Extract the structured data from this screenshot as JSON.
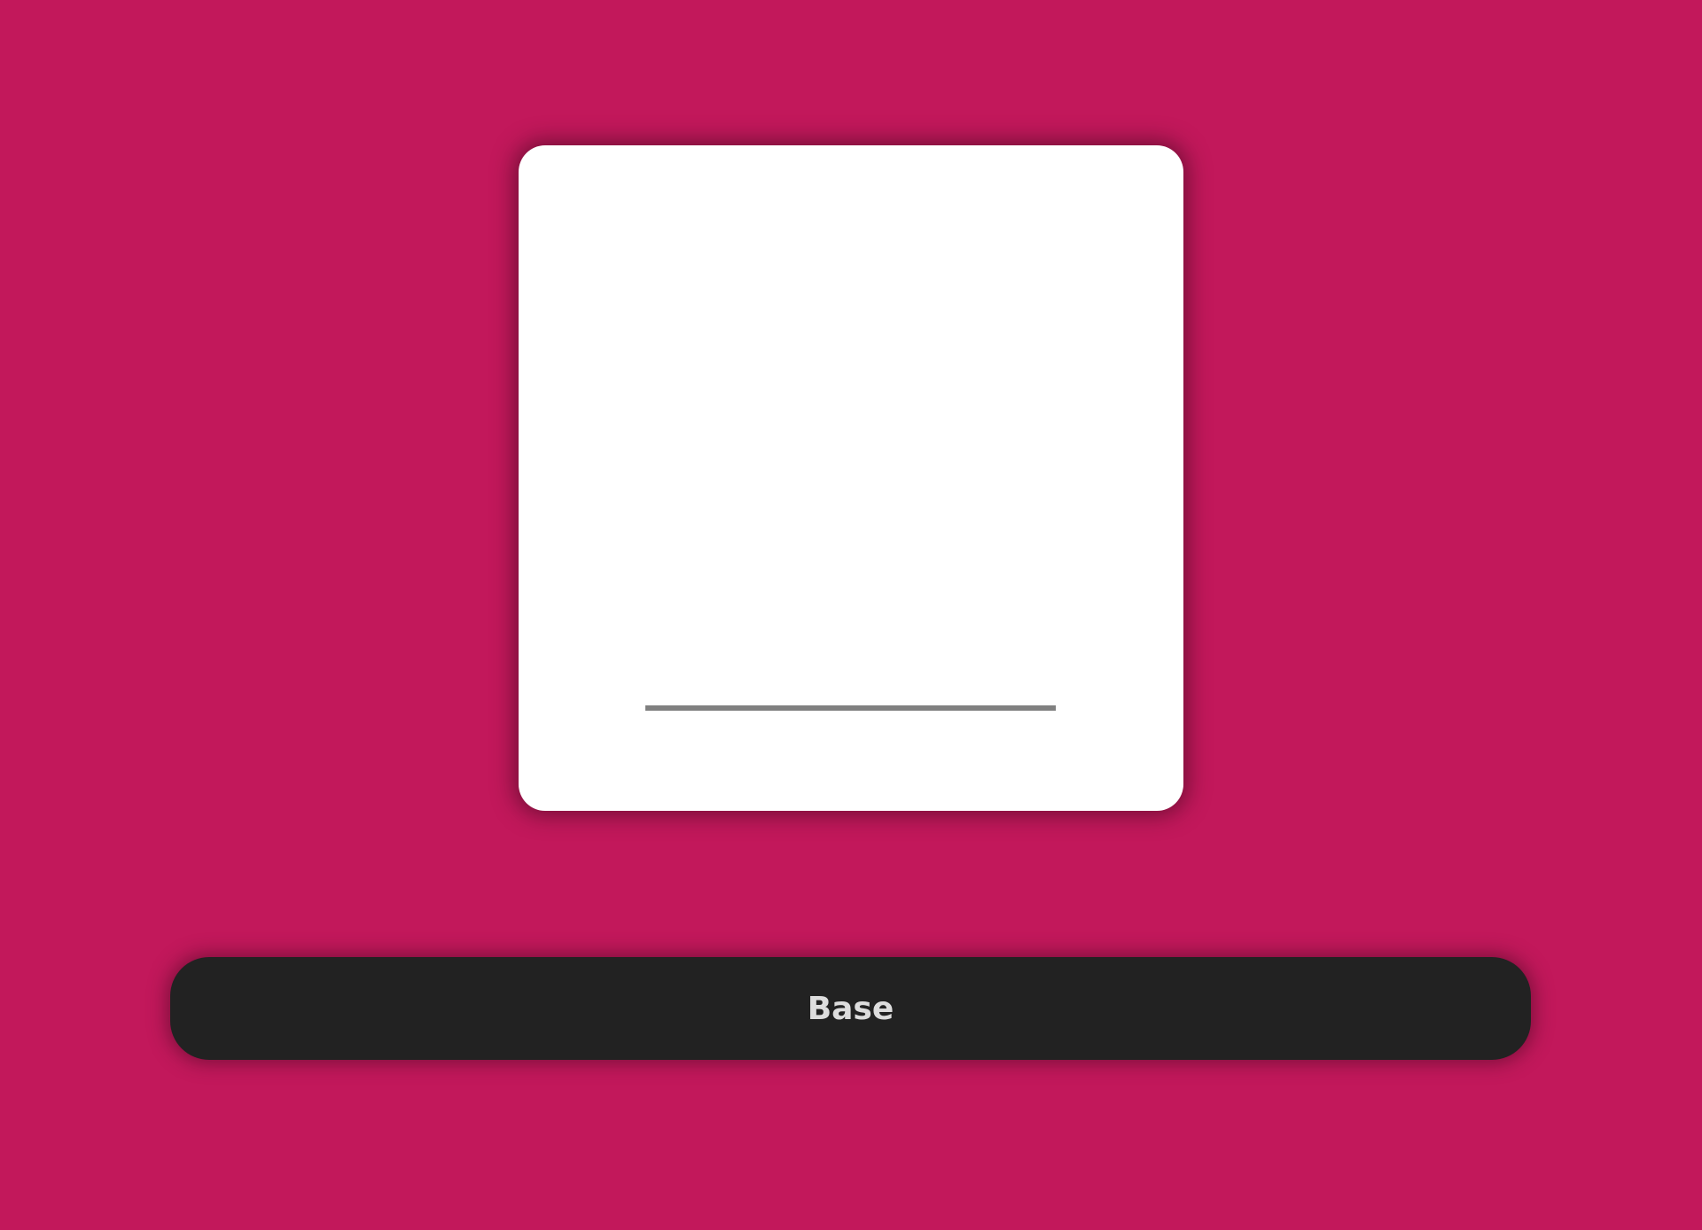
{
  "colors": {
    "background": "#c2185b",
    "card": "#ffffff",
    "input_underline": "#808080",
    "button_background": "#222222",
    "button_text": "#dddddd"
  },
  "card": {
    "input": {
      "value": "",
      "placeholder": ""
    }
  },
  "button": {
    "label": "Base"
  }
}
